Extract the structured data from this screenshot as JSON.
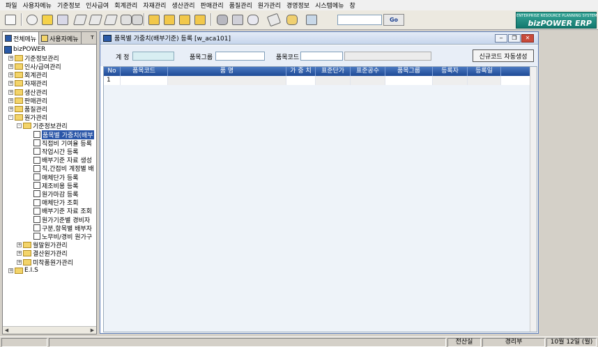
{
  "menu": [
    "파일",
    "사용자메뉴",
    "기준정보",
    "인사급여",
    "회계관리",
    "자재관리",
    "생산관리",
    "판매관리",
    "품질관리",
    "원가관리",
    "경영정보",
    "시스템메뉴",
    "창"
  ],
  "toolbar": {
    "icons": [
      "program-icon",
      "view-icon",
      "new-icon",
      "save-icon",
      "delete-icon",
      "print-icon",
      "print-preview-icon",
      "excel-icon",
      "trash-icon",
      "first-icon",
      "prev-icon",
      "next-icon",
      "last-icon",
      "db-icon",
      "report-icon",
      "search-doc-icon",
      "edit-icon",
      "refresh-icon",
      "exit-icon"
    ],
    "search_value": "",
    "go_label": "Go"
  },
  "logo": {
    "tagline": "ENTERPRISE RESOURCE PLANNING SYSTEM",
    "brand": "bizPOWER ERP",
    "color": "#12786e"
  },
  "left_panel": {
    "tabs": [
      "전체메뉴",
      "사용자메뉴"
    ],
    "pin": "ᴛ",
    "tree": [
      {
        "label": "bizPOWER",
        "kind": "root"
      },
      {
        "label": "기준정보관리",
        "kind": "folder",
        "sign": "+"
      },
      {
        "label": "인사/급여관리",
        "kind": "folder",
        "sign": "+"
      },
      {
        "label": "회계관리",
        "kind": "folder",
        "sign": "+"
      },
      {
        "label": "자재관리",
        "kind": "folder",
        "sign": "+"
      },
      {
        "label": "생산관리",
        "kind": "folder",
        "sign": "+"
      },
      {
        "label": "판매관리",
        "kind": "folder",
        "sign": "+"
      },
      {
        "label": "품질관리",
        "kind": "folder",
        "sign": "+"
      },
      {
        "label": "원가관리",
        "kind": "folder",
        "sign": "-"
      },
      {
        "label": "기준정보관리",
        "kind": "folder",
        "sign": "-"
      },
      {
        "label": "품목별 가중치(배부",
        "kind": "doc",
        "selected": true
      },
      {
        "label": "직접비 기여율 등록",
        "kind": "doc"
      },
      {
        "label": "작업시간 등록",
        "kind": "doc"
      },
      {
        "label": "배부기준 자료 생성",
        "kind": "doc"
      },
      {
        "label": "직,간접비 계정별 배",
        "kind": "doc"
      },
      {
        "label": "매체단가 등록",
        "kind": "doc"
      },
      {
        "label": "제조비용 등록",
        "kind": "doc"
      },
      {
        "label": "원가마감 등록",
        "kind": "doc"
      },
      {
        "label": "매체단가 조회",
        "kind": "doc"
      },
      {
        "label": "배부기준 자료 조회",
        "kind": "doc"
      },
      {
        "label": "원가기준별 경비자",
        "kind": "doc"
      },
      {
        "label": "구분,항목별 배부자",
        "kind": "doc"
      },
      {
        "label": "노무비/경비 원가구",
        "kind": "doc"
      },
      {
        "label": "월말원가관리",
        "kind": "folder",
        "sign": "+"
      },
      {
        "label": "결산원가관리",
        "kind": "folder",
        "sign": "+"
      },
      {
        "label": "미착품원가관리",
        "kind": "folder",
        "sign": "+"
      },
      {
        "label": "E.I.S",
        "kind": "folder",
        "sign": "+"
      }
    ]
  },
  "window": {
    "title": "품목별 가중치(배부기준) 등록 [w_aca101]",
    "form": {
      "account_label": "계 정",
      "account_value": "",
      "item_group_label": "품목그룹",
      "item_group_value": "",
      "item_code_label": "품목코드",
      "item_code_value": "",
      "item_name_value": "",
      "new_code_button": "신규코드 자동생성"
    },
    "grid": {
      "columns": [
        "No",
        "품목코드",
        "품 명",
        "가 중 치",
        "표준단가",
        "표준공수",
        "품목그룹",
        "등록자",
        "등록일"
      ],
      "rows": [
        [
          "1",
          "",
          "",
          "",
          "",
          "",
          "",
          "",
          ""
        ]
      ]
    }
  },
  "status": {
    "dept1": "전산실",
    "dept2": "경리부",
    "date": "10월 12일 (월)"
  }
}
